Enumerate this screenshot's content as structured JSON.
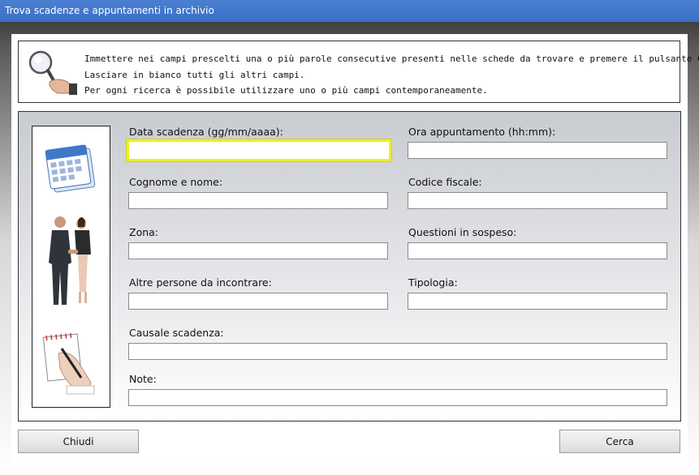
{
  "window": {
    "title": "Trova scadenze e appuntamenti in archivio"
  },
  "info": {
    "lines": [
      "Immettere nei campi prescelti una o più parole consecutive presenti nelle schede da trovare e premere il pulsante Cerca.",
      "Lasciare in bianco tutti gli altri campi.",
      "Per ogni ricerca è possibile utilizzare uno o più campi contemporaneamente."
    ]
  },
  "fields": {
    "data_scadenza": {
      "label": "Data scadenza (gg/mm/aaaa):",
      "value": ""
    },
    "ora_appuntamento": {
      "label": "Ora appuntamento (hh:mm):",
      "value": ""
    },
    "cognome_nome": {
      "label": "Cognome e nome:",
      "value": ""
    },
    "codice_fiscale": {
      "label": "Codice fiscale:",
      "value": ""
    },
    "zona": {
      "label": "Zona:",
      "value": ""
    },
    "questioni": {
      "label": "Questioni in sospeso:",
      "value": ""
    },
    "altre_persone": {
      "label": "Altre persone da incontrare:",
      "value": ""
    },
    "tipologia": {
      "label": "Tipologia:",
      "value": ""
    },
    "causale": {
      "label": "Causale scadenza:",
      "value": ""
    },
    "note": {
      "label": "Note:",
      "value": ""
    }
  },
  "buttons": {
    "close": "Chiudi",
    "search": "Cerca"
  },
  "icons": [
    "magnifier-hand-icon",
    "calendar-icon",
    "business-handshake-icon",
    "hand-writing-notepad-icon"
  ],
  "colors": {
    "titlebar": "#3f74cb",
    "focus_border": "#f0f020"
  }
}
